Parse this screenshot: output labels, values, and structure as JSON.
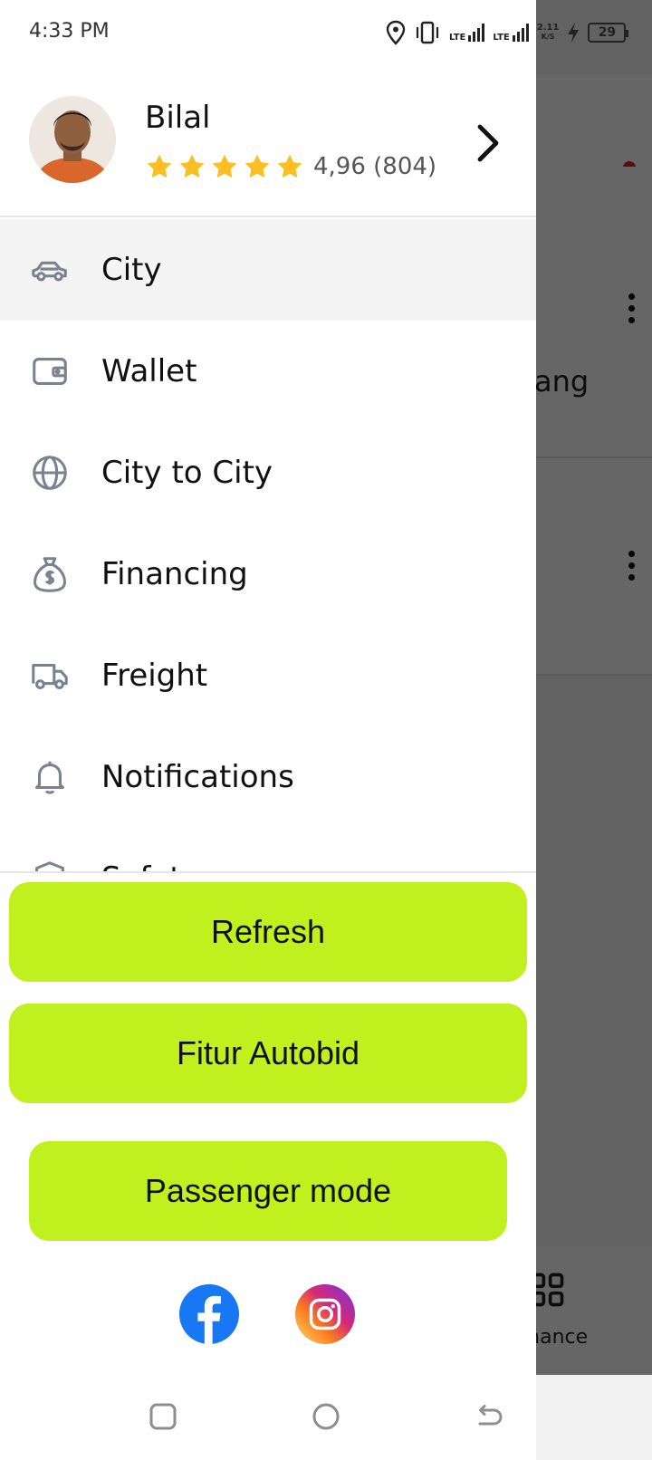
{
  "status_bar": {
    "time": "4:33 PM",
    "net1": "LTE",
    "net2": "LTE",
    "speed_value": "2.11",
    "speed_unit": "K/S",
    "battery": "29"
  },
  "profile": {
    "name": "Bilal",
    "stars": 5,
    "rating": "4,96",
    "reviews": "(804)",
    "rating_text": "4,96 (804)"
  },
  "menu": {
    "items": [
      {
        "label": "City",
        "icon": "car-icon",
        "active": true
      },
      {
        "label": "Wallet",
        "icon": "wallet-icon",
        "active": false
      },
      {
        "label": "City to City",
        "icon": "globe-icon",
        "active": false
      },
      {
        "label": "Financing",
        "icon": "money-bag-icon",
        "active": false
      },
      {
        "label": "Freight",
        "icon": "truck-icon",
        "active": false
      },
      {
        "label": "Notifications",
        "icon": "bell-icon",
        "active": false
      },
      {
        "label": "Safety",
        "icon": "shield-icon",
        "active": false
      }
    ]
  },
  "buttons": {
    "refresh": "Refresh",
    "autobid": "Fitur Autobid",
    "passenger": "Passenger mode"
  },
  "background": {
    "card_text": "ang",
    "nav_label": "rmance"
  },
  "colors": {
    "accent_button": "#c0f01e",
    "star": "#fbbf24",
    "icon_gray": "#7a8290",
    "active_row": "#f4f4f4",
    "notification_dot": "#d8281c",
    "facebook": "#1877f2"
  }
}
